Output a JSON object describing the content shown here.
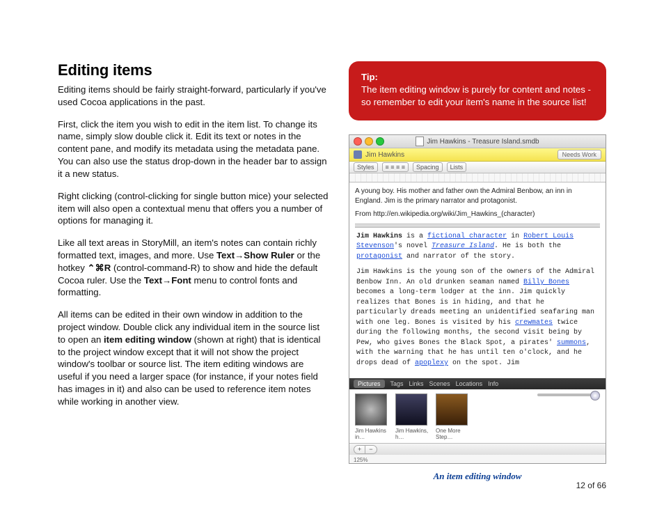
{
  "heading": "Editing items",
  "para1": "Editing items should be fairly straight-forward, particularly if you've used Cocoa applications in the past.",
  "para2": "First, click the item you wish to edit in the item list.  To change its name, simply slow double click it.  Edit its text or notes in the content pane, and modify its metadata using the metadata pane.  You can also use the status drop-down in the header bar to assign it a new status.",
  "para3": "Right clicking (control-clicking for single button mice) your selected item will also open a contextual menu that offers you a number of options for managing it.",
  "para4a": "Like all text areas in StoryMill, an item's notes can contain richly formatted text, images, and more.  Use ",
  "para4b": "Text→Show Ruler",
  "para4c": " or the hotkey ",
  "para4d": "⌃⌘R",
  "para4e": " (control-command-R) to show and hide the default Cocoa ruler.  Use the ",
  "para4f": "Text→Font",
  "para4g": " menu to control fonts and formatting.",
  "para5a": "All items can be edited in their own window in addition to the project window.  Double click any individual item in the source list to open an ",
  "para5b": "item editing window",
  "para5c": " (shown at right) that is identical to the project window except that it will not show the project window's toolbar or source list.  The item editing windows are useful if you need a larger space (for instance, if your notes field has images in it) and also can be used to reference item notes while working in another view.",
  "tip": {
    "title": "Tip:",
    "body": "The item editing window is purely for content and notes - so remember to edit your item's name in the source list!"
  },
  "window": {
    "title": "Jim Hawkins - Treasure Island.smdb",
    "item_name": "Jim Hawkins",
    "status": "Needs Work",
    "toolbar": {
      "styles": "Styles",
      "spacing": "Spacing",
      "lists": "Lists"
    },
    "notes_top1": "A young boy.  His mother and father own the Admiral Benbow, an inn in England.  Jim is the primary narrator and protagonist.",
    "notes_top2": "From http://en.wikipedia.org/wiki/Jim_Hawkins_(character)",
    "lower": {
      "l1a": "Jim Hawkins",
      "l1b": " is a ",
      "l1c": "fictional character",
      "l1d": " in ",
      "l1e": "Robert Louis Stevenson",
      "l1f": "'s novel ",
      "l1g": "Treasure Island",
      "l1h": ". He is both the ",
      "l1i": "protagonist",
      "l1j": " and narrator of the story.",
      "l2a": "Jim Hawkins is the young son of the owners of the Admiral Benbow Inn. An old drunken seaman named ",
      "l2b": "Billy Bones",
      "l2c": " becomes a long-term lodger at the inn. Jim quickly realizes that Bones is in hiding, and that he particularly dreads meeting an unidentified seafaring man with one leg. Bones is visited by his ",
      "l2d": "crewmates",
      "l2e": " twice during the following months, the second visit being by Pew, who gives Bones the Black Spot, a pirates' ",
      "l2f": "summons",
      "l2g": ", with the warning that he has until ten o'clock, and he drops dead of ",
      "l2h": "apoplexy",
      "l2i": " on the spot. Jim"
    },
    "tabs": [
      "Pictures",
      "Tags",
      "Links",
      "Scenes",
      "Locations",
      "Info"
    ],
    "thumbs": [
      {
        "label": "Jim Hawkins in…"
      },
      {
        "label": "Jim Hawkins, h…"
      },
      {
        "label": "One More Step…"
      }
    ],
    "zoom": "125%",
    "add": "+",
    "remove": "−"
  },
  "caption": "An item editing window",
  "page_number": "12 of 66"
}
